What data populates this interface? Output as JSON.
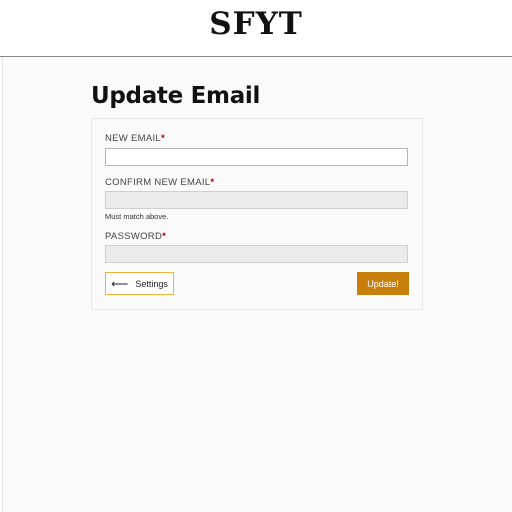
{
  "header": {
    "logo_text": "SFYT"
  },
  "page": {
    "title": "Update Email"
  },
  "form": {
    "new_email": {
      "label": "NEW EMAIL",
      "required_mark": "*",
      "value": ""
    },
    "confirm_email": {
      "label": "CONFIRM NEW EMAIL",
      "required_mark": "*",
      "value": "",
      "hint": "Must match above."
    },
    "password": {
      "label": "PASSWORD",
      "required_mark": "*",
      "value": ""
    },
    "back_button": {
      "icon": "left-arrow-icon",
      "label": "Settings"
    },
    "submit_button": {
      "label": "Update!"
    }
  },
  "colors": {
    "accent": "#c77f0c",
    "back_button_border": "#f0b43c",
    "required": "#b00000"
  }
}
